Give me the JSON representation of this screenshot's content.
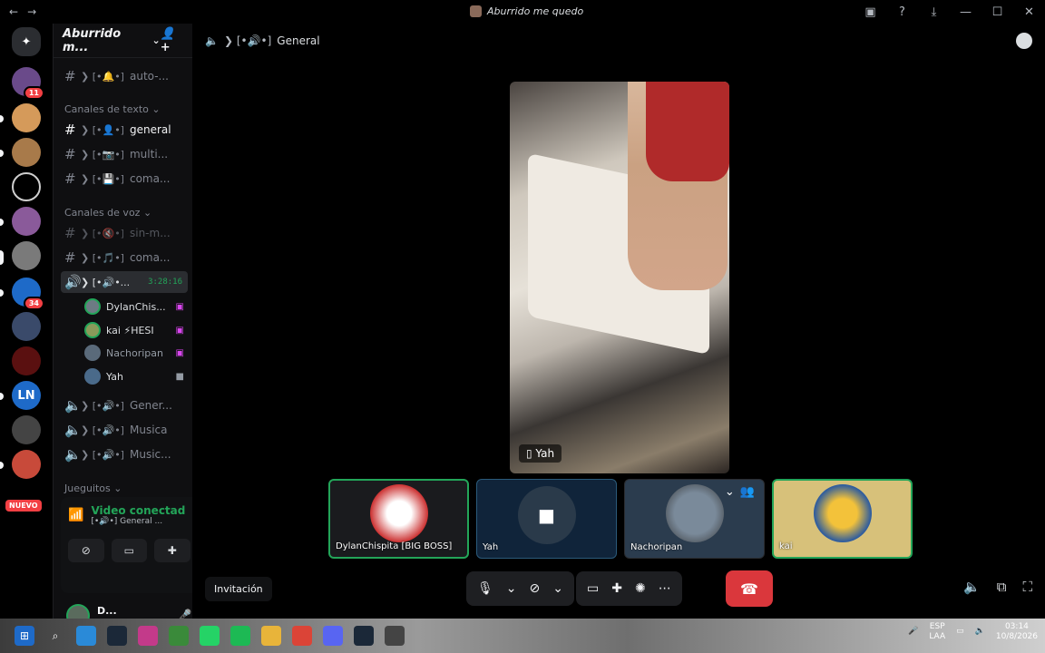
{
  "window": {
    "title": "Aburrido me quedo"
  },
  "server": {
    "name": "Aburrido m...",
    "category_text": "Canales de texto",
    "category_voice": "Canales de voz",
    "category_games": "Jueguitos"
  },
  "channels_top": [
    {
      "prefix": "❯ [•🔔•]",
      "name": "auto-..."
    }
  ],
  "channels_text": [
    {
      "prefix": "❯ [•👤•]",
      "name": "general"
    },
    {
      "prefix": "❯ [•📷•]",
      "name": "multi..."
    },
    {
      "prefix": "❯ [•💾•]",
      "name": "coma..."
    }
  ],
  "channels_voice": [
    {
      "prefix": "❯ [•🔇•]",
      "name": "sin-m..."
    },
    {
      "prefix": "❯ [•🎵•]",
      "name": "coma..."
    },
    {
      "prefix": "❯ [•🔊•...",
      "name": "",
      "timer": "3:28:16"
    }
  ],
  "voice_users": [
    {
      "name": "DylanChis..."
    },
    {
      "name": "kai ⚡HESI"
    },
    {
      "name": "Nachoripan"
    },
    {
      "name": "Yah"
    }
  ],
  "channels_voice_more": [
    {
      "prefix": "❯ [•🔊•]",
      "name": "Gener..."
    },
    {
      "prefix": "❯ [•🔊•]",
      "name": "Musica"
    },
    {
      "prefix": "❯ [•🔊•]",
      "name": "Music..."
    }
  ],
  "guild_badges": {
    "g1": "11",
    "g2": "34",
    "nuevo": "NUEVO"
  },
  "voice_panel": {
    "status": "Video conectad",
    "channel": "[•🔊•] General ..."
  },
  "user_panel": {
    "name": "D...",
    "status": "•"
  },
  "header": {
    "prefix": "❯ [•🔊•]",
    "channel": "General"
  },
  "stage": {
    "name": "Yah"
  },
  "tiles": [
    {
      "label": "DylanChispita [BIG BOSS]"
    },
    {
      "label": "Yah"
    },
    {
      "label": "Nachoripan"
    },
    {
      "label": "kai"
    }
  ],
  "bottom": {
    "invite": "Invitación"
  },
  "tray": {
    "lang1": "ESP",
    "lang2": "LAA",
    "time": "03:14",
    "date": "10/8/2026"
  },
  "colors": {
    "accent_green": "#23a559",
    "hangup": "#da373c",
    "streaming_badge": "#d946ef"
  }
}
